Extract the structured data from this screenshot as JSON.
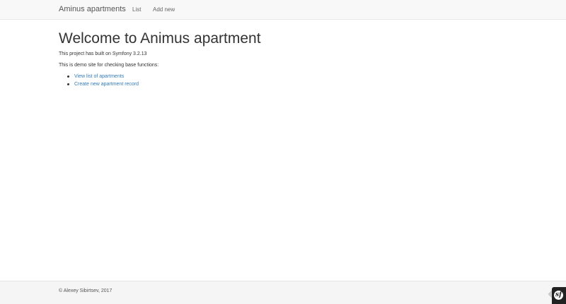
{
  "navbar": {
    "brand": "Aminus apartments",
    "items": [
      {
        "label": "List"
      },
      {
        "label": "Add new"
      }
    ]
  },
  "main": {
    "title": "Welcome to Animus apartment",
    "built_text": "This project has built on Symfony 3.2.13",
    "demo_text": "This is demo site for checking base functions:",
    "links": [
      {
        "label": "View list of apartments"
      },
      {
        "label": "Create new apartment record"
      }
    ]
  },
  "footer": {
    "copyright": "© Alexey Sibirtsev, 2017"
  },
  "debug_toolbar": {
    "logo_glyph": "sf",
    "icon": "symfony-icon"
  },
  "colors": {
    "navbar_bg": "#f8f8f8",
    "link": "#337ab7",
    "text": "#333333",
    "footer_bg": "#f5f5f5"
  }
}
